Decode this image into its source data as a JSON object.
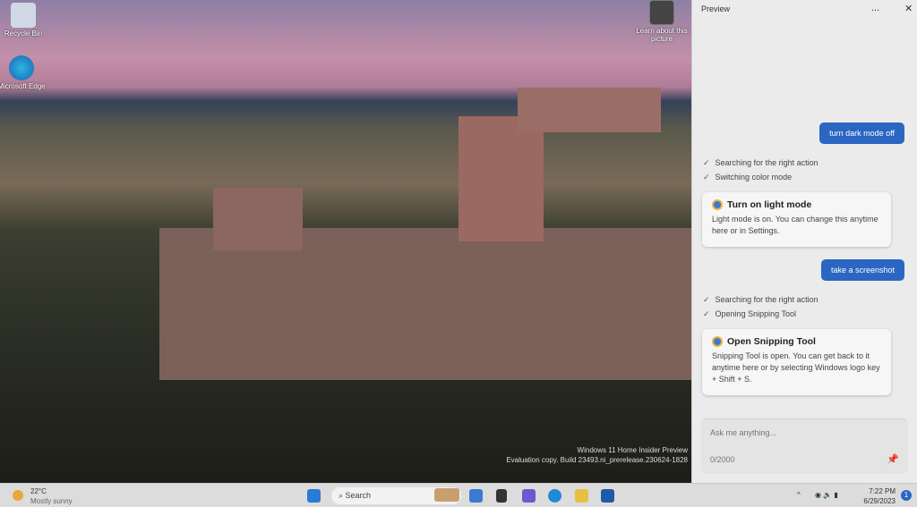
{
  "desktop": {
    "icons": [
      {
        "label": "Recycle Bin"
      },
      {
        "label": "Microsoft Edge"
      },
      {
        "label": "Learn about this picture"
      }
    ],
    "watermark": {
      "line1": "Windows 11 Home Insider Preview",
      "line2": "Evaluation copy. Build 23493.ni_prerelease.230624-1828"
    }
  },
  "panel": {
    "title": "Preview",
    "more_icon": "...",
    "close_icon": "✕",
    "messages": [
      {
        "type": "user",
        "text": "turn dark mode off"
      },
      {
        "type": "steps",
        "items": [
          "Searching for the right action",
          "Switching color mode"
        ]
      },
      {
        "type": "card",
        "title": "Turn on light mode",
        "body": "Light mode is on. You can change this anytime here or in Settings."
      },
      {
        "type": "user",
        "text": "take a screenshot"
      },
      {
        "type": "steps",
        "items": [
          "Searching for the right action",
          "Opening Snipping Tool"
        ]
      },
      {
        "type": "card",
        "title": "Open Snipping Tool",
        "body": "Snipping Tool is open. You can get back to it anytime here or by selecting Windows logo key + Shift + S."
      }
    ],
    "input": {
      "placeholder": "Ask me anything...",
      "value": "",
      "counter": "0/2000"
    }
  },
  "taskbar": {
    "weather_temp": "22°C",
    "weather_desc": "Mostly sunny",
    "search": "Search",
    "time": "7:22 PM",
    "date": "6/29/2023",
    "notification_count": "1"
  },
  "colors": {
    "accent": "#2a66c2"
  }
}
